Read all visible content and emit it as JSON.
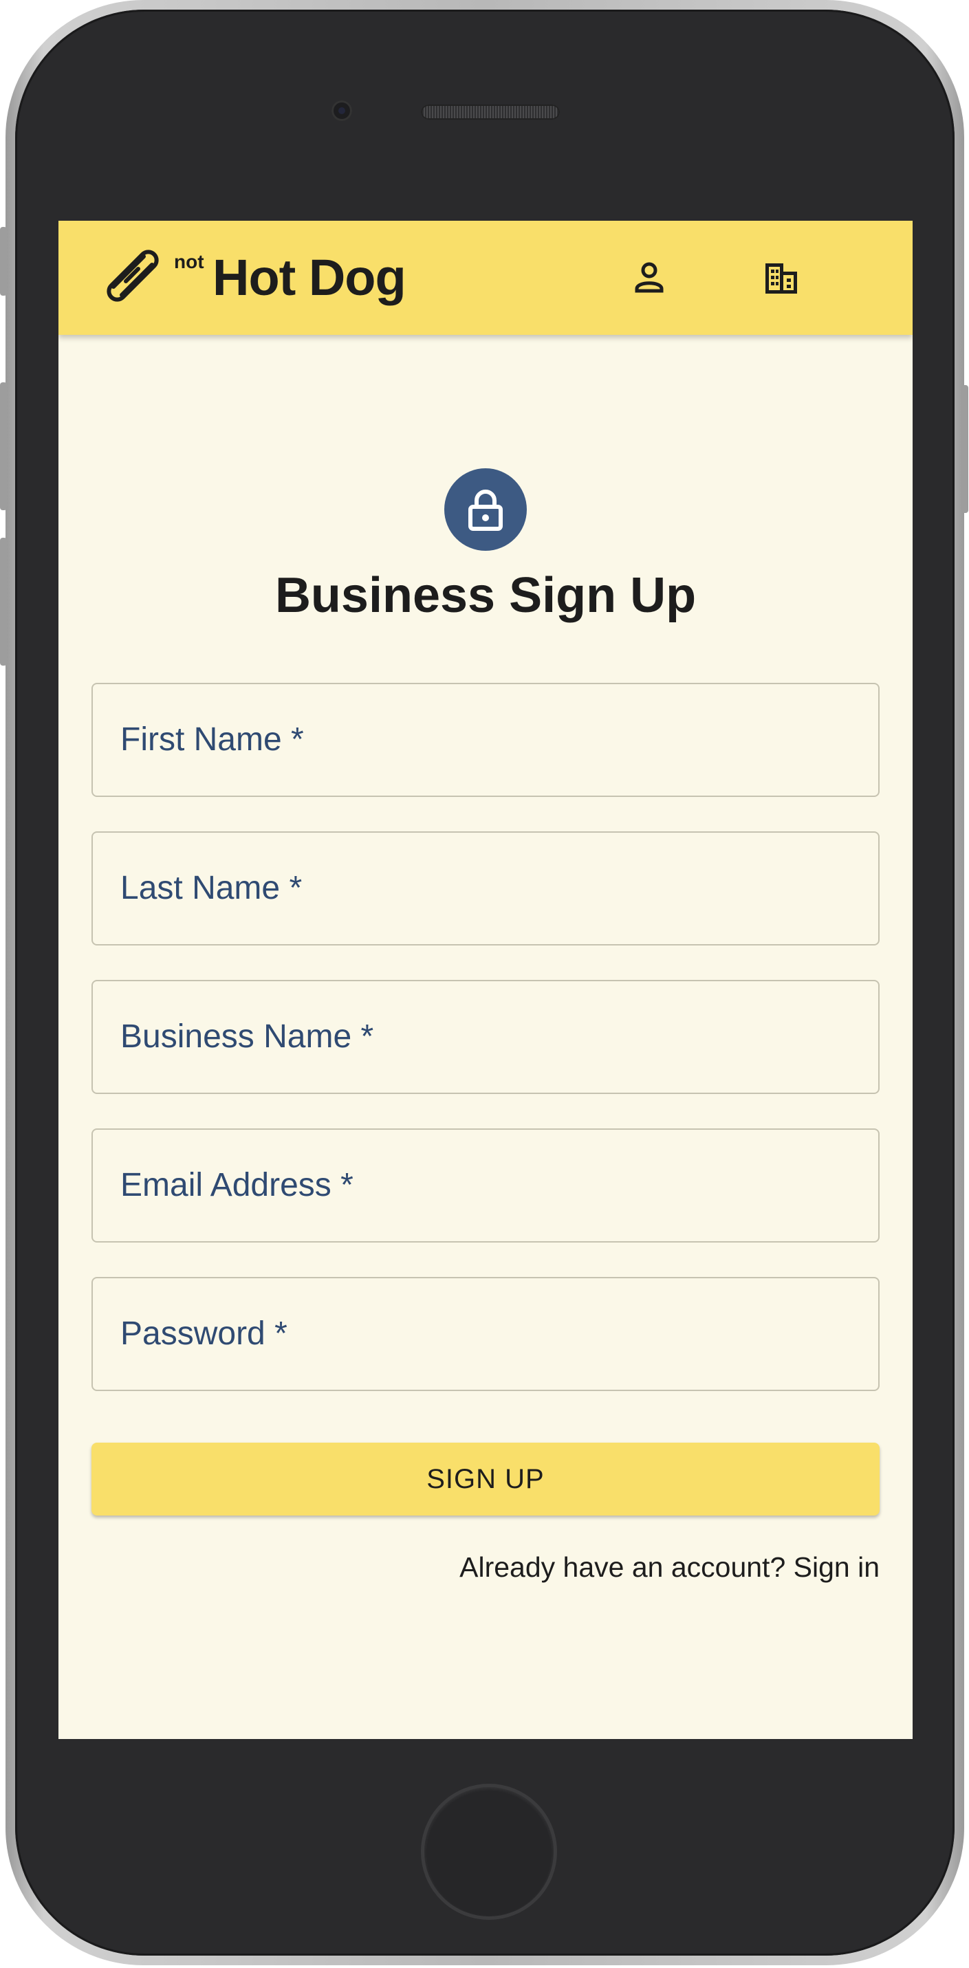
{
  "app_bar": {
    "brand_prefix": "not",
    "brand_name": "Hot Dog",
    "brand_icon": "hotdog-icon",
    "user_icon": "user-icon",
    "business_icon": "building-icon",
    "background_color": "#f9df6a"
  },
  "form": {
    "icon": "lock-icon",
    "icon_color": "#3d5a83",
    "title": "Business Sign Up",
    "fields": [
      {
        "label": "First Name *"
      },
      {
        "label": "Last Name *"
      },
      {
        "label": "Business Name *"
      },
      {
        "label": "Email Address *"
      },
      {
        "label": "Password *"
      }
    ],
    "submit_label": "SIGN UP",
    "signin_link": "Already have an account? Sign in"
  },
  "colors": {
    "screen_background": "#fbf8e8",
    "label_color": "#2f4a72",
    "accent": "#f9df6a"
  }
}
